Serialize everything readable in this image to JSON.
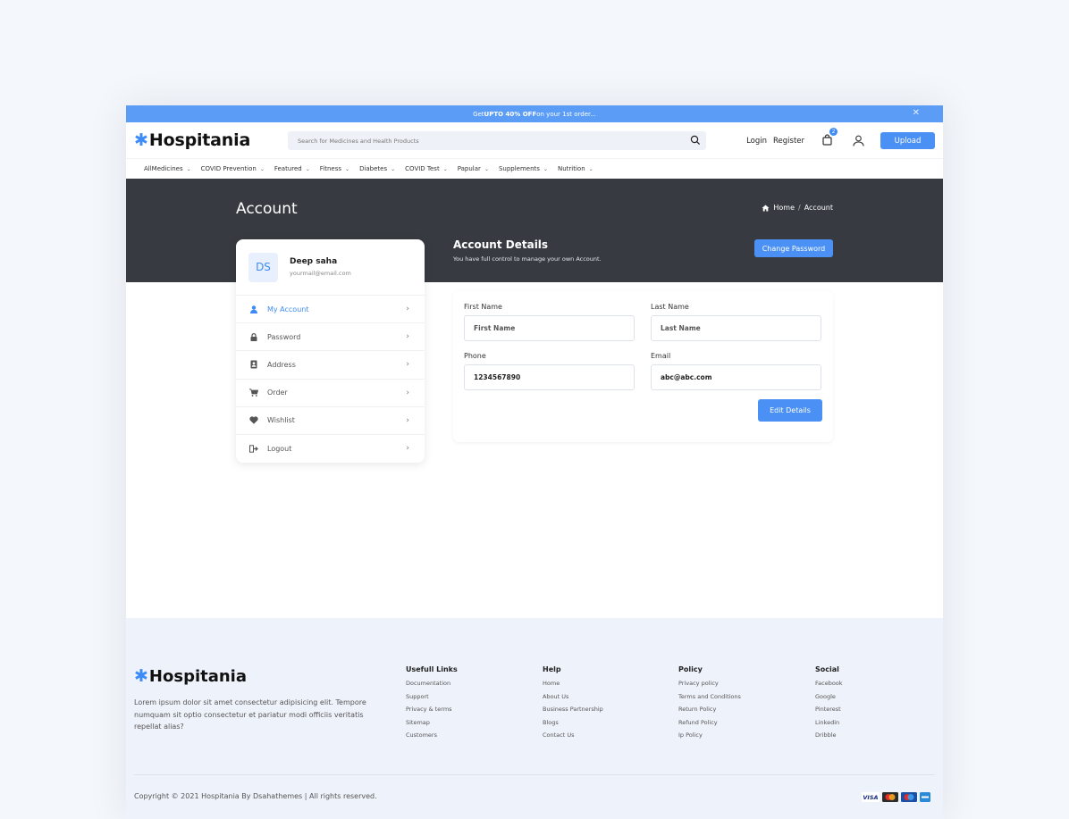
{
  "promo": {
    "pre": "Get ",
    "bold": "UPTO 40% OFF",
    "post": " on your 1st order..."
  },
  "brand": {
    "name": "Hospitania"
  },
  "search": {
    "placeholder": "Search for Medicines and Health Products"
  },
  "header": {
    "login": "Login",
    "register": "Register",
    "cart_count": "2",
    "upload": "Upload"
  },
  "categories": [
    "AllMedicines",
    "COVID Prevention",
    "Featured",
    "Fitness",
    "Diabetes",
    "COVID Test",
    "Papular",
    "Supplements",
    "Nutrition"
  ],
  "hero": {
    "title": "Account",
    "crumb_home": "Home",
    "crumb_current": "Account"
  },
  "account": {
    "title": "Account Details",
    "subtitle": "You have full control to manage your own Account.",
    "change_password": "Change Password"
  },
  "profile": {
    "initials": "DS",
    "name": "Deep saha",
    "email": "yourmail@email.com"
  },
  "menu": [
    {
      "label": "My Account",
      "icon": "user-icon",
      "active": true
    },
    {
      "label": "Password",
      "icon": "lock-icon"
    },
    {
      "label": "Address",
      "icon": "address-book-icon"
    },
    {
      "label": "Order",
      "icon": "cart-icon"
    },
    {
      "label": "Wishlist",
      "icon": "heart-icon"
    },
    {
      "label": "Logout",
      "icon": "logout-icon"
    }
  ],
  "form": {
    "first_name": {
      "label": "First Name",
      "placeholder": "First Name"
    },
    "last_name": {
      "label": "Last Name",
      "placeholder": "Last Name"
    },
    "phone": {
      "label": "Phone",
      "value": "1234567890"
    },
    "email": {
      "label": "Email",
      "value": "abc@abc.com"
    },
    "edit": "Edit Details"
  },
  "footer": {
    "desc": "Lorem ipsum dolor sit amet consectetur adipisicing elit. Tempore numquam sit optio consectetur et pariatur modi officiis veritatis repellat alias?",
    "columns": [
      {
        "title": "Usefull Links",
        "links": [
          "Documentation",
          "Support",
          "Privacy & terms",
          "Sitemap",
          "Customers"
        ]
      },
      {
        "title": "Help",
        "links": [
          "Home",
          "About Us",
          "Business Partnership",
          "Blogs",
          "Contact Us"
        ]
      },
      {
        "title": "Policy",
        "links": [
          "Privacy policy",
          "Terms and Conditions",
          "Return Policy",
          "Refund Policy",
          "Ip Policy"
        ]
      },
      {
        "title": "Social",
        "links": [
          "Facebook",
          "Google",
          "Pinterest",
          "Linkedin",
          "Dribble"
        ]
      }
    ],
    "copyright": "Copyright © 2021 Hospitania By Dsahathemes | All rights reserved.",
    "payments": [
      "visa-icon",
      "mastercard-icon",
      "maestro-icon",
      "amex-icon"
    ],
    "visa_text": "VISA"
  },
  "colors": {
    "accent": "#4a90f5",
    "hero_bg": "#373b41",
    "footer_bg": "#eef2fa"
  }
}
